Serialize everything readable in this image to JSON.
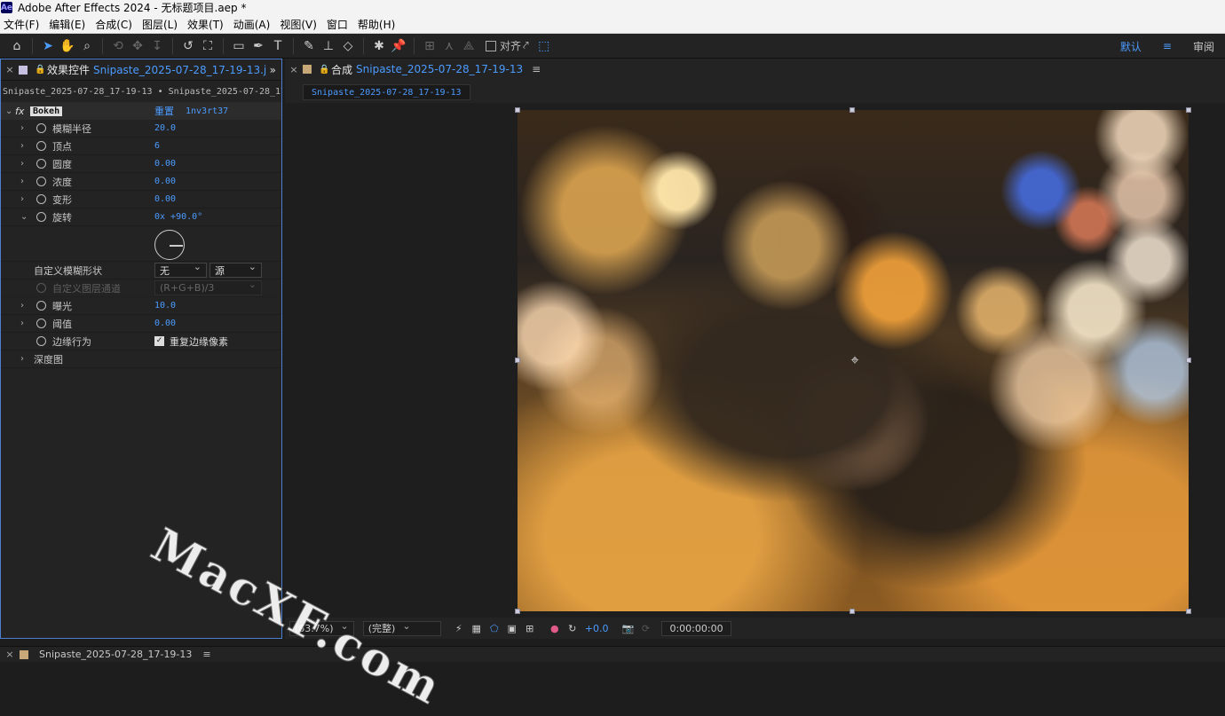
{
  "app": {
    "window_title": "Adobe After Effects 2024 - 无标题项目.aep *",
    "logo_text": "Ae"
  },
  "menu": [
    "文件(F)",
    "编辑(E)",
    "合成(C)",
    "图层(L)",
    "效果(T)",
    "动画(A)",
    "视图(V)",
    "窗口",
    "帮助(H)"
  ],
  "toolbar": {
    "snap_label": "对齐",
    "workspace_default": "默认",
    "workspace_menu_icon": "≡",
    "workspace_review": "审阅"
  },
  "effect_controls": {
    "tab_title": "效果控件",
    "tab_source": "Snipaste_2025-07-28_17-19-13.j",
    "layer_path": "Snipaste_2025-07-28_17-19-13 • Snipaste_2025-07-28_17",
    "effect_name": "Bokeh",
    "reset_label": "重置",
    "credit": "1nv3rt37",
    "params": [
      {
        "name": "模糊半径",
        "value": "20.0"
      },
      {
        "name": "顶点",
        "value": "6"
      },
      {
        "name": "圆度",
        "value": "0.00"
      },
      {
        "name": "浓度",
        "value": "0.00"
      },
      {
        "name": "变形",
        "value": "0.00"
      },
      {
        "name": "旋转",
        "value": "0x +90.0°"
      }
    ],
    "custom_shape_label": "自定义模糊形状",
    "custom_shape_value": "无",
    "source_value": "源",
    "custom_layer_channel_label": "自定义图层通道",
    "custom_layer_channel_value": "(R+G+B)/3",
    "exposure": {
      "name": "曝光",
      "value": "10.0"
    },
    "threshold": {
      "name": "阈值",
      "value": "0.00"
    },
    "edge_behavior": {
      "name": "边缘行为",
      "value": "重复边缘像素"
    },
    "depth_map": "深度图"
  },
  "composition": {
    "panel_title": "合成",
    "panel_source": "Snipaste_2025-07-28_17-19-13",
    "comp_tab": "Snipaste_2025-07-28_17-19-13",
    "zoom": "(63.7%)",
    "resolution": "(完整)",
    "exposure_value": "+0.0",
    "timecode": "0:00:00:00"
  },
  "timeline": {
    "tab": "Snipaste_2025-07-28_17-19-13"
  },
  "watermark": "MacXF.com"
}
